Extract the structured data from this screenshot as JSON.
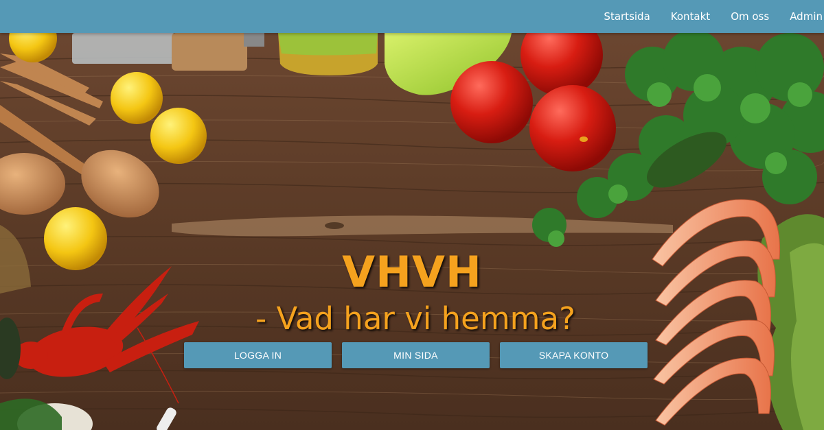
{
  "nav": {
    "items": [
      {
        "label": "Startsida"
      },
      {
        "label": "Kontakt"
      },
      {
        "label": "Om oss"
      },
      {
        "label": "Admin"
      }
    ]
  },
  "hero": {
    "title": "VHVH",
    "subtitle": "- Vad har vi hemma?"
  },
  "buttons": {
    "login": "LOGGA IN",
    "my_page": "MIN SIDA",
    "create_account": "SKAPA KONTO"
  },
  "colors": {
    "navbar": "#5599b6",
    "accent": "#f5a21e",
    "wood": "#5a3a24"
  }
}
